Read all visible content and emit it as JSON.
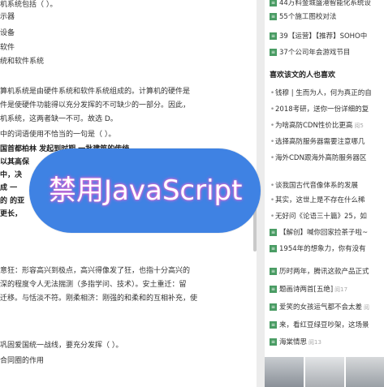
{
  "left": {
    "lines": [
      "机系统包括（ ）。",
      "示器",
      "设备",
      "软件",
      "统和软件系统",
      "",
      "算机系统是由硬件系统和软件系统组成的。计算机的硬件是",
      "件是使硬件功能得以充分发挥的不可缺少的一部分。因此，",
      "机系统，这两者缺一不可。故选 D。",
      "中的词语使用不恰当的一句是（ ）。",
      "国首都柏林  发起到时期  一批建筑的传统",
      "以其高保",
      "中，决",
      "成 一",
      "的 的亚",
      "更长，"
    ],
    "bottom_lines": [
      "意狂：形容高兴到极点，高兴得像发了狂，也指十分高兴的",
      "深的程度令人无法揣测（多指学问、技术）。安土重迁：留",
      "迁移。与恬淡不符。刚柔相济：刚强的和柔和的互相补充，使",
      "",
      "巩固爱国统一战线，要充分发挥（ ）。",
      "合同圈的作用"
    ]
  },
  "right": {
    "top_items": [
      {
        "text": "44万料金城盛港智能化系统设",
        "icon": "square"
      },
      {
        "text": "55个施工图校对法",
        "icon": "square"
      },
      {
        "text": "39【运营】【推荐】SOHO中",
        "icon": "square"
      },
      {
        "text": "37个公司年会游戏节目",
        "icon": "square"
      }
    ],
    "section_title": "喜欢该文的人也喜欢",
    "dot_items": [
      {
        "text": "钱穆 | 生而为人，何为真正的自"
      },
      {
        "text": "2018考研，送你一份详细的复"
      },
      {
        "text": "为啥高防CDN性价比更高",
        "views": "阅5"
      },
      {
        "text": "选择高防服务器需要注意哪几"
      },
      {
        "text": "海外CDN跟海外高防服务器区"
      },
      {
        "text": "谈我国古代音像体系的发展"
      },
      {
        "text": "其实，这世上是不存在什么稀"
      },
      {
        "text": "无好问《论语三十篇》25，如"
      },
      {
        "text": "【解创】喊你回家捡茶子啦~"
      },
      {
        "text": "1954年的想象力，你有没有"
      }
    ],
    "square_items": [
      {
        "text": "历时两年，腾讯这款产品正式"
      },
      {
        "text": "题画诗两首[五绝]",
        "views": "阅17"
      },
      {
        "text": "爱笑的女孩运气都不会太差",
        "views": "阅"
      },
      {
        "text": "来，看红豆绿豆吵架，这场景"
      },
      {
        "text": "海棠情思",
        "views": "阅13"
      }
    ]
  },
  "overlay": {
    "message": "禁用JavaScript"
  },
  "colors": {
    "popup": "#3f82e3",
    "accent_green": "#4a9c64"
  }
}
